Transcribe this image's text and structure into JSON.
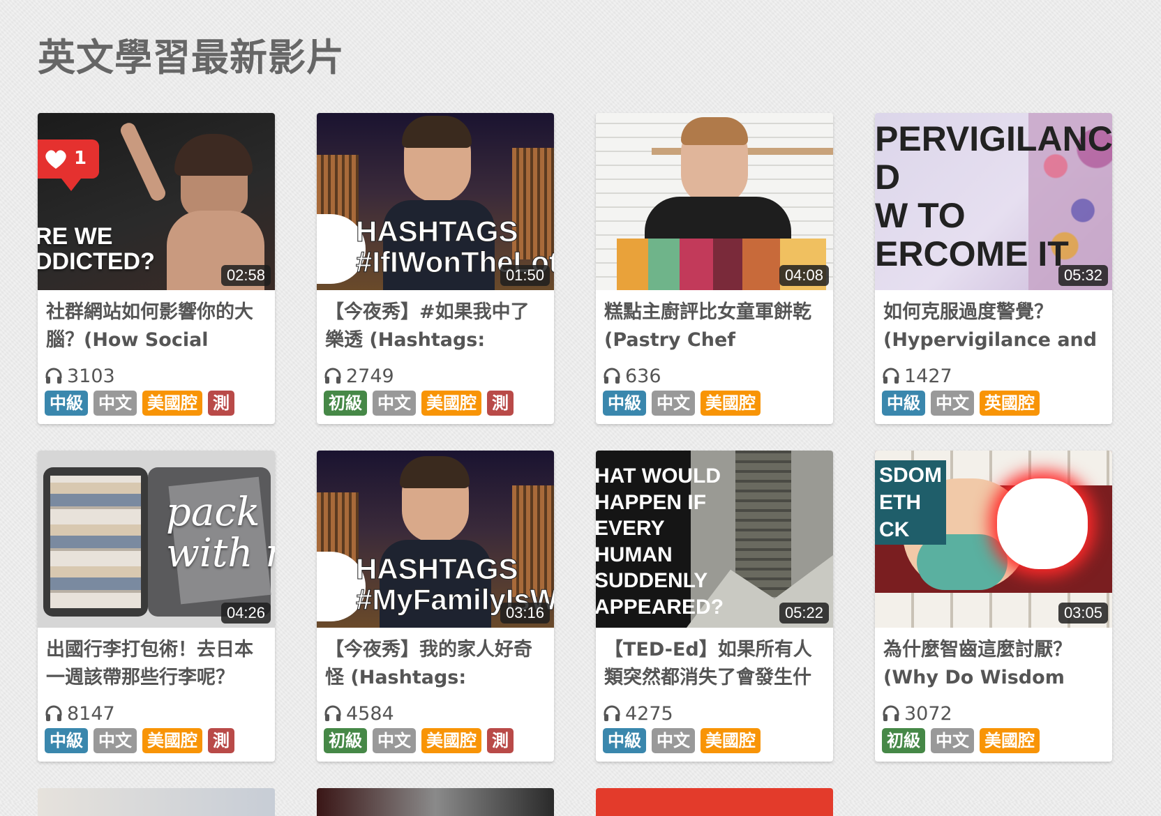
{
  "page": {
    "title": "英文學習最新影片"
  },
  "colors": {
    "level_mid": "#3a87ad",
    "level_beg": "#468847",
    "lang": "#999999",
    "accent": "#f89406",
    "test": "#b94a48"
  },
  "videos": [
    {
      "thumb_lines": "RE WE\nDDICTED?",
      "duration": "02:58",
      "title": "社群網站如何影響你的大腦？(How Social Media",
      "plays": "3103",
      "tags": {
        "level": "中級",
        "lang": "中文",
        "accent": "美國腔",
        "test": "測"
      }
    },
    {
      "thumb_lines": "HASHTAGS\n#IfIWonTheLottery",
      "duration": "01:50",
      "title": "【今夜秀】#如果我中了樂透 (Hashtags:",
      "plays": "2749",
      "tags": {
        "level": "初級",
        "lang": "中文",
        "accent": "美國腔",
        "test": "測"
      }
    },
    {
      "thumb_lines": "",
      "duration": "04:08",
      "title": "糕點主廚評比女童軍餅乾 (Pastry Chef Reviews",
      "plays": "636",
      "tags": {
        "level": "中級",
        "lang": "中文",
        "accent": "美國腔"
      }
    },
    {
      "thumb_lines": "PERVIGILANCE\nD\nW TO\nERCOME IT",
      "duration": "05:32",
      "title": "如何克服過度警覺？(Hypervigilance and",
      "plays": "1427",
      "tags": {
        "level": "中級",
        "lang": "中文",
        "accent": "英國腔"
      }
    },
    {
      "thumb_lines": "pack\nwith me",
      "duration": "04:26",
      "title": "出國行李打包術！去日本一週該帶那些行李呢？",
      "plays": "8147",
      "tags": {
        "level": "中級",
        "lang": "中文",
        "accent": "美國腔",
        "test": "測"
      }
    },
    {
      "thumb_lines": "HASHTAGS\n#MyFamilyIsWeird",
      "duration": "03:16",
      "title": "【今夜秀】我的家人好奇怪 (Hashtags:",
      "plays": "4584",
      "tags": {
        "level": "初級",
        "lang": "中文",
        "accent": "美國腔",
        "test": "測"
      }
    },
    {
      "thumb_lines": "HAT WOULD\nHAPPEN IF\nEVERY\nHUMAN\nSUDDENLY\nAPPEARED?",
      "duration": "05:22",
      "title": "【TED-Ed】如果所有人類突然都消失了會發生什",
      "plays": "4275",
      "tags": {
        "level": "中級",
        "lang": "中文",
        "accent": "美國腔"
      }
    },
    {
      "thumb_lines": "SDOM\nETH\nCK",
      "duration": "03:05",
      "title": "為什麼智齒這麼討厭？(Why Do Wisdom Teeth",
      "plays": "3072",
      "tags": {
        "level": "初級",
        "lang": "中文",
        "accent": "美國腔"
      }
    }
  ]
}
